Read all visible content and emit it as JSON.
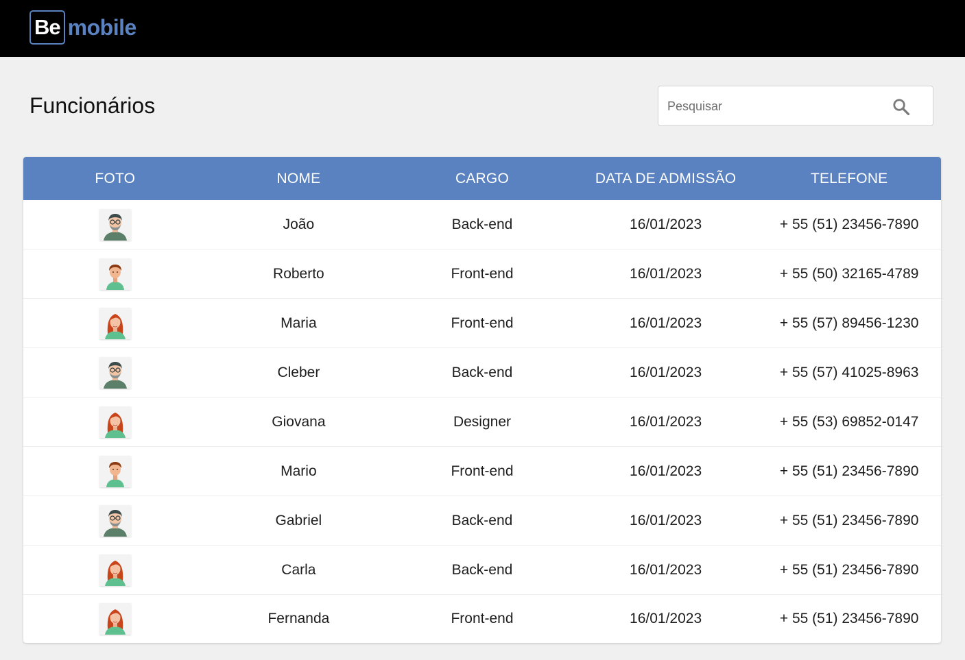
{
  "header": {
    "logo_box_text": "Be",
    "logo_word_text": "mobile"
  },
  "page": {
    "title": "Funcionários"
  },
  "search": {
    "placeholder": "Pesquisar",
    "value": ""
  },
  "table": {
    "columns": [
      "FOTO",
      "NOME",
      "CARGO",
      "DATA DE ADMISSÃO",
      "TELEFONE"
    ],
    "rows": [
      {
        "avatar": "man-glasses-beard-avatar",
        "nome": "João",
        "cargo": "Back-end",
        "data": "16/01/2023",
        "telefone": "+ 55 (51) 23456-7890"
      },
      {
        "avatar": "young-man-avatar",
        "nome": "Roberto",
        "cargo": "Front-end",
        "data": "16/01/2023",
        "telefone": "+ 55 (50) 32165-4789"
      },
      {
        "avatar": "woman-red-hair-avatar",
        "nome": "Maria",
        "cargo": "Front-end",
        "data": "16/01/2023",
        "telefone": "+ 55 (57) 89456-1230"
      },
      {
        "avatar": "man-glasses-beard-avatar",
        "nome": "Cleber",
        "cargo": "Back-end",
        "data": "16/01/2023",
        "telefone": "+ 55 (57) 41025-8963"
      },
      {
        "avatar": "woman-red-hair-avatar",
        "nome": "Giovana",
        "cargo": "Designer",
        "data": "16/01/2023",
        "telefone": "+ 55 (53) 69852-0147"
      },
      {
        "avatar": "young-man-avatar",
        "nome": "Mario",
        "cargo": "Front-end",
        "data": "16/01/2023",
        "telefone": "+ 55 (51) 23456-7890"
      },
      {
        "avatar": "man-glasses-beard-avatar",
        "nome": "Gabriel",
        "cargo": "Back-end",
        "data": "16/01/2023",
        "telefone": "+ 55 (51) 23456-7890"
      },
      {
        "avatar": "woman-red-hair-avatar",
        "nome": "Carla",
        "cargo": "Back-end",
        "data": "16/01/2023",
        "telefone": "+ 55 (51) 23456-7890"
      },
      {
        "avatar": "woman-red-hair-avatar",
        "nome": "Fernanda",
        "cargo": "Front-end",
        "data": "16/01/2023",
        "telefone": "+ 55 (51) 23456-7890"
      }
    ]
  },
  "colors": {
    "header_bg": "#000000",
    "accent": "#5a82c0",
    "page_bg": "#f0f0f0"
  }
}
